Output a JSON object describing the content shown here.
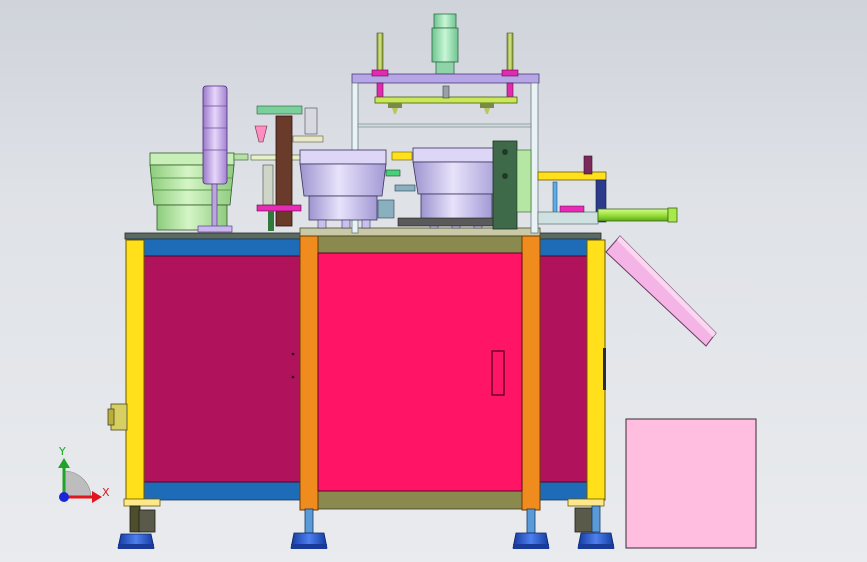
{
  "triad": {
    "x_label": "X",
    "y_label": "Y",
    "x_color": "#e0161e",
    "y_color": "#1fa32a",
    "z_color": "#1b25d8"
  },
  "colors": {
    "background": "#dfe2e7",
    "cabinet_door": "#b0125c",
    "front_door": "#ff1466",
    "frame_yellow": "#ffe01a",
    "frame_orange": "#f08c1e",
    "frame_blue": "#1e6cb8",
    "bowl_green": "#b6e6a4",
    "bowl_lavender": "#c8bfe9",
    "tower_purple": "#c9a7ea",
    "cylinder_green": "#9fe2b4",
    "guard_pink": "#ffbde0",
    "chute_pink": "#f4b4e6",
    "rod_green": "#9be23a",
    "feet_blue": "#1f4fc7"
  }
}
